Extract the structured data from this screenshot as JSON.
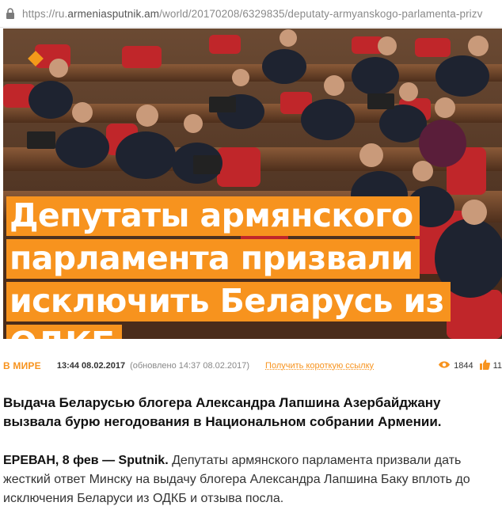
{
  "browser": {
    "url_prefix": "https://ru.",
    "url_host": "armeniasputnik.am",
    "url_path": "/world/20170208/6329835/deputaty-armyanskogo-parlamenta-prizv"
  },
  "article": {
    "headline_lines": [
      "Депутаты армянского",
      "парламента призвали",
      "исключить Беларусь из",
      "ОДКБ"
    ],
    "rubric": "В МИРЕ",
    "published": "13:44 08.02.2017",
    "updated": "(обновлено 14:37 08.02.2017)",
    "short_link": "Получить короткую ссылку",
    "views": "1844",
    "likes": "11",
    "lead": "Выдача Беларусью блогера Александра Лапшина Азербайджану вызвала бурю негодования в Национальном собрании Армении.",
    "dateline": "ЕРЕВАН, 8 фев — Sputnik.",
    "body": " Депутаты армянского парламента призвали дать жесткий ответ Минску на выдачу блогера Александра Лапшина Баку вплоть до исключения Беларуси из ОДКБ и отзыва посла."
  },
  "colors": {
    "accent": "#f7931e",
    "icon_eye": "eye-icon",
    "icon_like": "thumbs-up-icon",
    "icon_lock": "lock-icon"
  }
}
